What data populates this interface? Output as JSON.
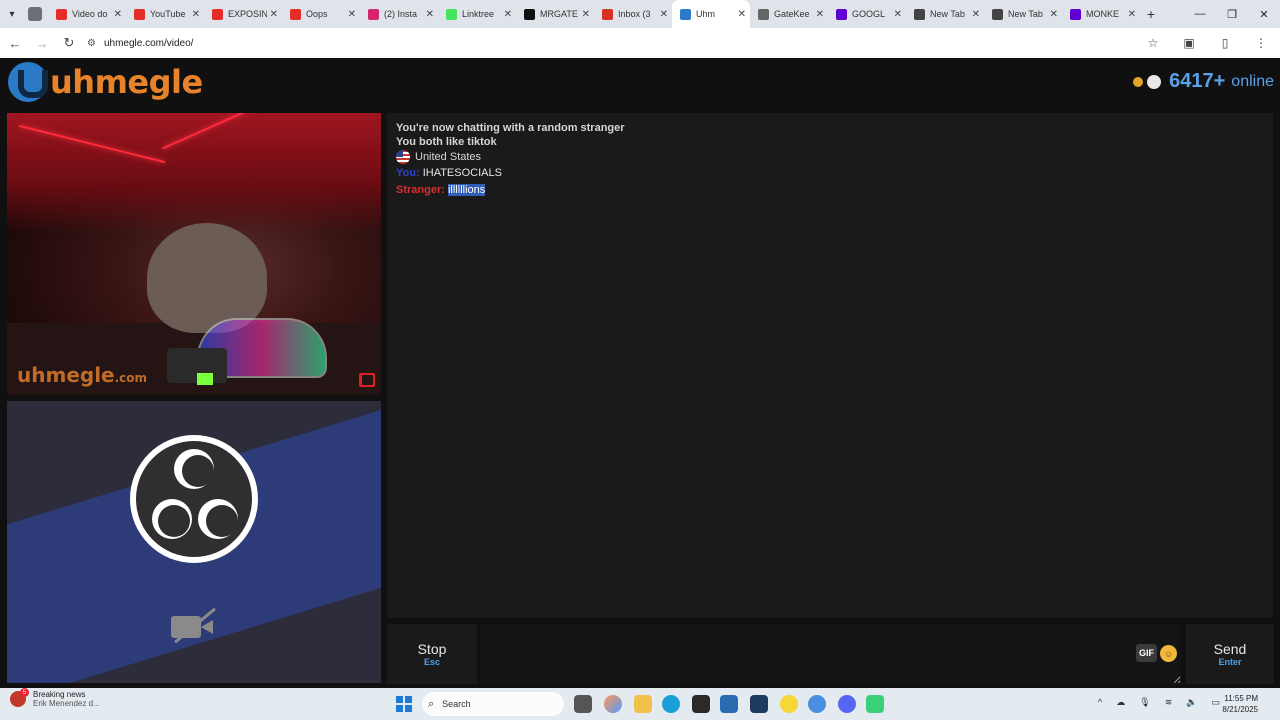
{
  "browser": {
    "tabs": [
      {
        "title": "Video do",
        "favicon": "youtube-icon",
        "color": "#e52d27"
      },
      {
        "title": "YouTube",
        "favicon": "youtube-icon",
        "color": "#e52d27"
      },
      {
        "title": "EXPOSIN",
        "favicon": "youtube-icon",
        "color": "#e52d27"
      },
      {
        "title": "Oops",
        "favicon": "youtube-icon",
        "color": "#e52d27"
      },
      {
        "title": "(2) Insta",
        "favicon": "instagram-icon",
        "color": "#d6246e"
      },
      {
        "title": "Linktree",
        "favicon": "linktree-icon",
        "color": "#43e55e"
      },
      {
        "title": "MRGATE",
        "favicon": "notion-icon",
        "color": "#111111"
      },
      {
        "title": "Inbox (3",
        "favicon": "gmail-icon",
        "color": "#d93025"
      },
      {
        "title": "Uhm",
        "favicon": "uhmegle-icon",
        "color": "#2b7ac7",
        "active": true
      },
      {
        "title": "GateKee",
        "favicon": "globe-icon",
        "color": "#666666"
      },
      {
        "title": "GOOGL",
        "favicon": "yahoo-icon",
        "color": "#6001d2"
      },
      {
        "title": "New Tab",
        "favicon": "search-icon",
        "color": "#444444"
      },
      {
        "title": "New Tab",
        "favicon": "search-icon",
        "color": "#444444"
      },
      {
        "title": "MONKE",
        "favicon": "yahoo-icon",
        "color": "#6001d2"
      }
    ],
    "url": "uhmegle.com/video/"
  },
  "header": {
    "logo_text": "uhmegle",
    "online_count": "6417+",
    "online_label": "online"
  },
  "stranger_video": {
    "watermark": "uhmegle",
    "watermark_suffix": ".com"
  },
  "chat": {
    "system_lines": [
      "You're now chatting with a random stranger",
      "You both like tiktok"
    ],
    "country": "United States",
    "messages": [
      {
        "sender": "You:",
        "text": "IHATESOCIALS"
      },
      {
        "sender": "Stranger:",
        "text": "illllllions"
      }
    ]
  },
  "controls": {
    "stop_label": "Stop",
    "stop_key": "Esc",
    "gif_label": "GIF",
    "send_label": "Send",
    "send_key": "Enter"
  },
  "taskbar": {
    "news_badge": "5",
    "news_title": "Breaking news",
    "news_sub": "Erik Menendez d...",
    "search_label": "Search",
    "time": "11:55 PM",
    "date": "8/21/2025"
  },
  "colors": {
    "accent_orange": "#e8832c",
    "online_blue": "#5aa0ea",
    "you_blue": "#2b45c8",
    "stranger_red": "#d83030"
  }
}
